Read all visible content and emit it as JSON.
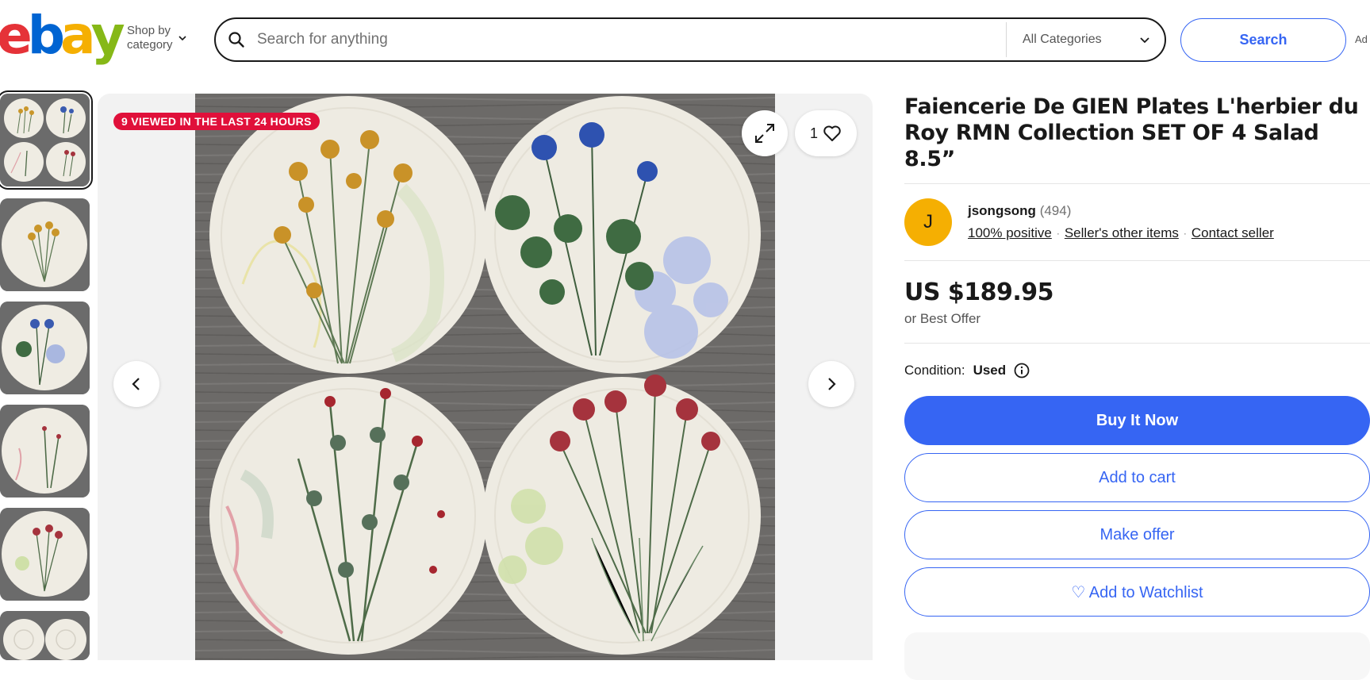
{
  "header": {
    "logo_letters": [
      "e",
      "b",
      "a",
      "y"
    ],
    "logo_colors": [
      "#e53238",
      "#0064d2",
      "#f5af02",
      "#86b817"
    ],
    "shop_by_line1": "Shop by",
    "shop_by_line2": "category",
    "search_placeholder": "Search for anything",
    "category_label": "All Categories",
    "search_button": "Search",
    "advanced_label": "Ad"
  },
  "gallery": {
    "viewed_badge": "9 VIEWED IN THE LAST 24 HOURS",
    "watch_count": "1",
    "thumbnails": [
      "all-four-plates",
      "yellow-flower-plate",
      "blue-flower-plate",
      "pink-herb-plate",
      "red-flower-plate",
      "plate-backs"
    ]
  },
  "listing": {
    "title": "Faiencerie De GIEN Plates L'herbier du Roy RMN Collection SET OF 4 Salad 8.5”",
    "seller": {
      "initial": "J",
      "name": "jsongsong",
      "feedback": "(494)",
      "positive": "100% positive",
      "other_items": "Seller's other items",
      "contact": "Contact seller"
    },
    "price": "US $189.95",
    "best_offer": "or Best Offer",
    "condition_label": "Condition:",
    "condition_value": "Used",
    "buttons": {
      "buy": "Buy It Now",
      "cart": "Add to cart",
      "offer": "Make offer",
      "watch": "♡ Add to Watchlist"
    }
  },
  "colors": {
    "accent": "#3665f3",
    "badge": "#e0103a",
    "avatar": "#f5af02"
  }
}
